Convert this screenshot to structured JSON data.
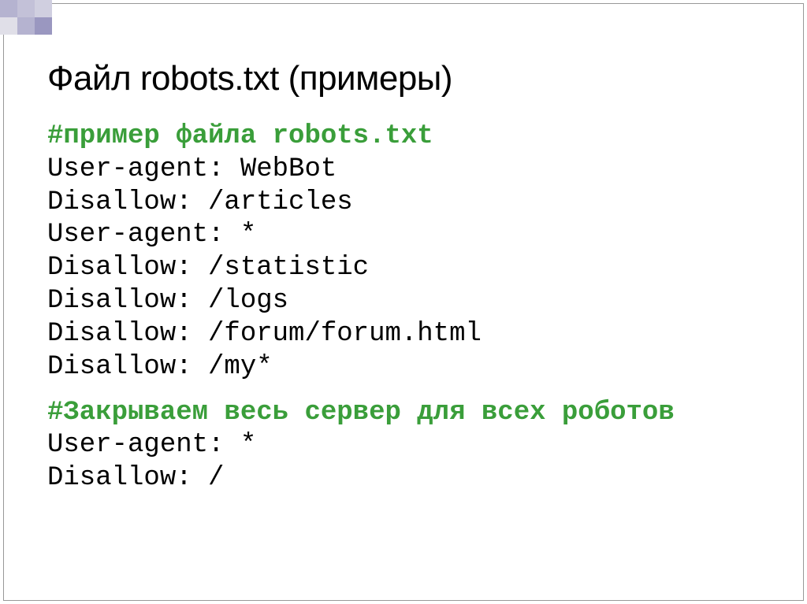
{
  "title": "Файл robots.txt (примеры)",
  "block1": {
    "comment": "#пример файла robots.txt",
    "lines": [
      "User-agent: WebBot",
      "Disallow: /articles",
      "User-agent: *",
      "Disallow: /statistic",
      "Disallow: /logs",
      "Disallow: /forum/forum.html",
      "Disallow: /my*"
    ]
  },
  "block2": {
    "comment": "#Закрываем весь сервер для всех роботов",
    "lines": [
      "User-agent: *",
      "Disallow: /"
    ]
  }
}
